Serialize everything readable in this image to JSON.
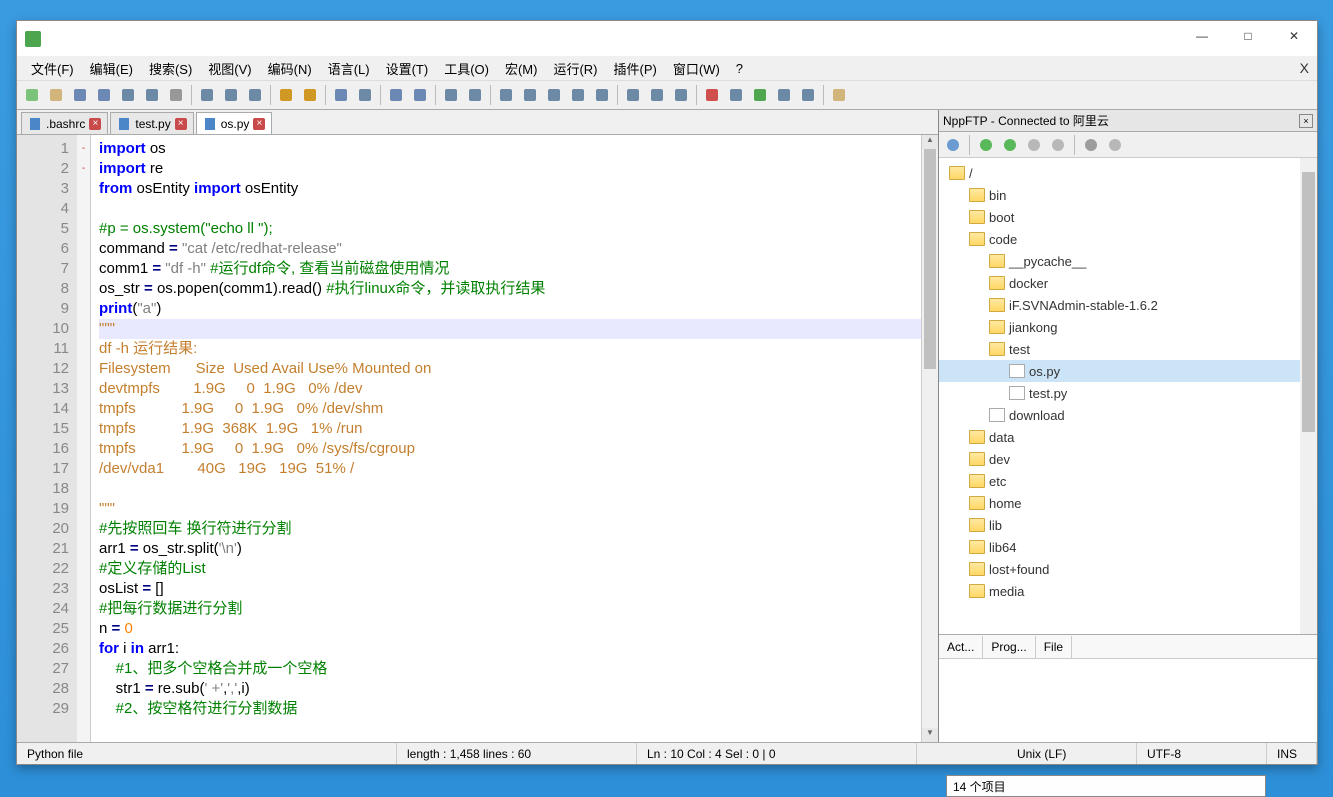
{
  "window": {
    "minimize": "—",
    "maximize": "□",
    "close": "✕"
  },
  "menu": {
    "file": "文件(F)",
    "edit": "编辑(E)",
    "search": "搜索(S)",
    "view": "视图(V)",
    "encoding": "编码(N)",
    "language": "语言(L)",
    "settings": "设置(T)",
    "tools": "工具(O)",
    "macro": "宏(M)",
    "run": "运行(R)",
    "plugins": "插件(P)",
    "window": "窗口(W)",
    "help": "?",
    "close_doc": "X"
  },
  "tabs": [
    {
      "label": ".bashrc",
      "dirty": true,
      "active": false
    },
    {
      "label": "test.py",
      "dirty": true,
      "active": false
    },
    {
      "label": "os.py",
      "dirty": true,
      "active": true
    }
  ],
  "code": {
    "lines": [
      {
        "n": 1,
        "tokens": [
          [
            "kw",
            "import"
          ],
          [
            "id",
            " os"
          ]
        ]
      },
      {
        "n": 2,
        "tokens": [
          [
            "kw",
            "import"
          ],
          [
            "id",
            " re"
          ]
        ]
      },
      {
        "n": 3,
        "tokens": [
          [
            "kw",
            "from"
          ],
          [
            "id",
            " osEntity "
          ],
          [
            "kw",
            "import"
          ],
          [
            "id",
            " osEntity"
          ]
        ]
      },
      {
        "n": 4,
        "tokens": []
      },
      {
        "n": 5,
        "tokens": [
          [
            "cmt",
            "#p = os.system(\"echo ll \");"
          ]
        ]
      },
      {
        "n": 6,
        "tokens": [
          [
            "id",
            "command "
          ],
          [
            "op",
            "="
          ],
          [
            "id",
            " "
          ],
          [
            "str",
            "\"cat /etc/redhat-release\""
          ]
        ]
      },
      {
        "n": 7,
        "tokens": [
          [
            "id",
            "comm1 "
          ],
          [
            "op",
            "="
          ],
          [
            "id",
            " "
          ],
          [
            "str",
            "\"df -h\""
          ],
          [
            "id",
            " "
          ],
          [
            "cmt",
            "#运行df命令, 查看当前磁盘使用情况"
          ]
        ]
      },
      {
        "n": 8,
        "tokens": [
          [
            "id",
            "os_str "
          ],
          [
            "op",
            "="
          ],
          [
            "id",
            " os.popen(comm1).read() "
          ],
          [
            "cmt",
            "#执行linux命令，并读取执行结果"
          ]
        ]
      },
      {
        "n": 9,
        "fold": "-",
        "tokens": [
          [
            "kw",
            "print"
          ],
          [
            "id",
            "("
          ],
          [
            "str",
            "\"a\""
          ],
          [
            "id",
            ")"
          ]
        ]
      },
      {
        "n": 10,
        "hl": true,
        "tokens": [
          [
            "docstr",
            "\"\"\""
          ]
        ]
      },
      {
        "n": 11,
        "tokens": [
          [
            "docstr",
            "df -h 运行结果:"
          ]
        ]
      },
      {
        "n": 12,
        "tokens": [
          [
            "docstr",
            "Filesystem      Size  Used Avail Use% Mounted on"
          ]
        ]
      },
      {
        "n": 13,
        "tokens": [
          [
            "docstr",
            "devtmpfs        1.9G     0  1.9G   0% /dev"
          ]
        ]
      },
      {
        "n": 14,
        "tokens": [
          [
            "docstr",
            "tmpfs           1.9G     0  1.9G   0% /dev/shm"
          ]
        ]
      },
      {
        "n": 15,
        "tokens": [
          [
            "docstr",
            "tmpfs           1.9G  368K  1.9G   1% /run"
          ]
        ]
      },
      {
        "n": 16,
        "tokens": [
          [
            "docstr",
            "tmpfs           1.9G     0  1.9G   0% /sys/fs/cgroup"
          ]
        ]
      },
      {
        "n": 17,
        "tokens": [
          [
            "docstr",
            "/dev/vda1        40G   19G   19G  51% /"
          ]
        ]
      },
      {
        "n": 18,
        "tokens": []
      },
      {
        "n": 19,
        "tokens": [
          [
            "docstr",
            "\"\"\""
          ]
        ]
      },
      {
        "n": 20,
        "tokens": [
          [
            "cmt",
            "#先按照回车 换行符进行分割"
          ]
        ]
      },
      {
        "n": 21,
        "tokens": [
          [
            "id",
            "arr1 "
          ],
          [
            "op",
            "="
          ],
          [
            "id",
            " os_str.split("
          ],
          [
            "str",
            "'\\n'"
          ],
          [
            "id",
            ")"
          ]
        ]
      },
      {
        "n": 22,
        "tokens": [
          [
            "cmt",
            "#定义存储的List"
          ]
        ]
      },
      {
        "n": 23,
        "tokens": [
          [
            "id",
            "osList "
          ],
          [
            "op",
            "="
          ],
          [
            "id",
            " []"
          ]
        ]
      },
      {
        "n": 24,
        "tokens": [
          [
            "cmt",
            "#把每行数据进行分割"
          ]
        ]
      },
      {
        "n": 25,
        "tokens": [
          [
            "id",
            "n "
          ],
          [
            "op",
            "="
          ],
          [
            "id",
            " "
          ],
          [
            "num",
            "0"
          ]
        ]
      },
      {
        "n": 26,
        "fold": "-",
        "tokens": [
          [
            "kw",
            "for"
          ],
          [
            "id",
            " i "
          ],
          [
            "kw",
            "in"
          ],
          [
            "id",
            " arr1:"
          ]
        ]
      },
      {
        "n": 27,
        "tokens": [
          [
            "id",
            "    "
          ],
          [
            "cmt",
            "#1、把多个空格合并成一个空格"
          ]
        ]
      },
      {
        "n": 28,
        "tokens": [
          [
            "id",
            "    str1 "
          ],
          [
            "op",
            "="
          ],
          [
            "id",
            " re.sub("
          ],
          [
            "str",
            "' +'"
          ],
          [
            "id",
            ","
          ],
          [
            "str",
            "','"
          ],
          [
            "id",
            ",i)"
          ]
        ]
      },
      {
        "n": 29,
        "tokens": [
          [
            "id",
            "    "
          ],
          [
            "cmt",
            "#2、按空格符进行分割数据"
          ]
        ]
      }
    ]
  },
  "panel": {
    "title": "NppFTP - Connected to 阿里云",
    "tree": [
      {
        "depth": 0,
        "type": "folder",
        "label": "/"
      },
      {
        "depth": 1,
        "type": "folder",
        "label": "bin"
      },
      {
        "depth": 1,
        "type": "folder",
        "label": "boot"
      },
      {
        "depth": 1,
        "type": "folder",
        "label": "code"
      },
      {
        "depth": 2,
        "type": "folder",
        "label": "__pycache__"
      },
      {
        "depth": 2,
        "type": "folder",
        "label": "docker"
      },
      {
        "depth": 2,
        "type": "folder",
        "label": "iF.SVNAdmin-stable-1.6.2"
      },
      {
        "depth": 2,
        "type": "folder",
        "label": "jiankong"
      },
      {
        "depth": 2,
        "type": "folder",
        "label": "test"
      },
      {
        "depth": 3,
        "type": "file",
        "label": "os.py",
        "selected": true
      },
      {
        "depth": 3,
        "type": "file",
        "label": "test.py"
      },
      {
        "depth": 2,
        "type": "file",
        "label": "download"
      },
      {
        "depth": 1,
        "type": "folder",
        "label": "data"
      },
      {
        "depth": 1,
        "type": "folder",
        "label": "dev"
      },
      {
        "depth": 1,
        "type": "folder",
        "label": "etc"
      },
      {
        "depth": 1,
        "type": "folder",
        "label": "home"
      },
      {
        "depth": 1,
        "type": "folder",
        "label": "lib"
      },
      {
        "depth": 1,
        "type": "folder",
        "label": "lib64"
      },
      {
        "depth": 1,
        "type": "folder",
        "label": "lost+found"
      },
      {
        "depth": 1,
        "type": "folder",
        "label": "media"
      }
    ],
    "bottom_tabs": [
      "Act...",
      "Prog...",
      "File"
    ]
  },
  "status": {
    "lang": "Python file",
    "length": "length : 1,458    lines : 60",
    "pos": "Ln : 10    Col : 4    Sel : 0 | 0",
    "eol": "Unix (LF)",
    "enc": "UTF-8",
    "ins": "INS"
  },
  "taskbar": {
    "text": "14 个项目"
  }
}
